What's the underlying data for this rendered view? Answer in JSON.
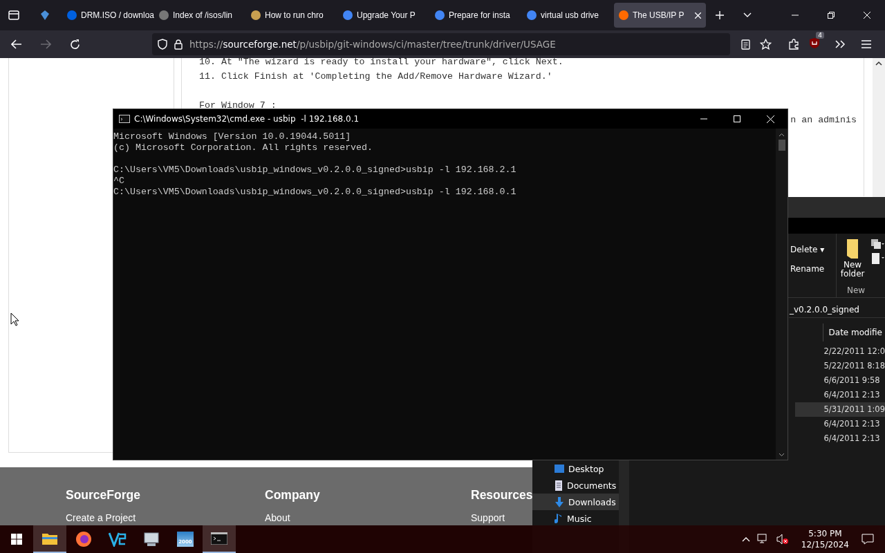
{
  "browser": {
    "tabs": [
      {
        "label": "DRM.ISO / downloa",
        "selected": false
      },
      {
        "label": "Index of /isos/lin",
        "selected": false
      },
      {
        "label": "How to run chro",
        "selected": false
      },
      {
        "label": "Upgrade Your P",
        "selected": false
      },
      {
        "label": "Prepare for insta",
        "selected": false
      },
      {
        "label": "virtual usb drive",
        "selected": false
      },
      {
        "label": "The USB/IP P",
        "selected": true
      }
    ],
    "forward_disabled": true,
    "url": {
      "scheme": "https://",
      "domain": "sourceforge.net",
      "path": "/p/usbip/git-windows/ci/master/tree/trunk/driver/USAGE"
    },
    "extension_badge": "4"
  },
  "page": {
    "lines": [
      {
        "text": "10. At \"The wizard is ready to install your hardware\", click Next.",
        "gap_before": false
      },
      {
        "text": "11. Click Finish at 'Completing the Add/Remove Hardware Wizard.'",
        "gap_before": false
      },
      {
        "text": "For Window 7 :",
        "gap_before": true
      }
    ],
    "partial_line": "n an adminis",
    "footer": [
      {
        "heading": "SourceForge",
        "link": "Create a Project"
      },
      {
        "heading": "Company",
        "link": "About"
      },
      {
        "heading": "Resources",
        "link": "Support"
      }
    ]
  },
  "explorer": {
    "delete": "Delete",
    "delete_caret": "▾",
    "rename": "Rename",
    "new_folder": "New folder",
    "group": "New",
    "address": "_v0.2.0.0_signed",
    "column": "Date modifie",
    "rows": [
      {
        "date": "2/22/2011 12:0",
        "selected": false
      },
      {
        "date": "5/22/2011 8:18",
        "selected": false
      },
      {
        "date": "6/6/2011 9:58",
        "selected": false
      },
      {
        "date": "6/4/2011 2:13",
        "selected": false
      },
      {
        "date": "5/31/2011 1:09",
        "selected": true
      },
      {
        "date": "6/4/2011 2:13",
        "selected": false
      },
      {
        "date": "6/4/2011 2:13",
        "selected": false
      }
    ],
    "nav": [
      {
        "kind": "desktop",
        "label": "Desktop",
        "selected": false
      },
      {
        "kind": "documents",
        "label": "Documents",
        "selected": false
      },
      {
        "kind": "downloads",
        "label": "Downloads",
        "selected": true
      },
      {
        "kind": "music",
        "label": "Music",
        "selected": false
      }
    ]
  },
  "cmd": {
    "title": "C:\\Windows\\System32\\cmd.exe - usbip  -l 192.168.0.1",
    "blocks": [
      [
        "Microsoft Windows [Version 10.0.19044.5011]",
        "(c) Microsoft Corporation. All rights reserved."
      ],
      [
        "C:\\Users\\VM5\\Downloads\\usbip_windows_v0.2.0.0_signed>usbip -l 192.168.2.1",
        "^C",
        "C:\\Users\\VM5\\Downloads\\usbip_windows_v0.2.0.0_signed>usbip -l 192.168.0.1"
      ]
    ]
  },
  "taskbar": {
    "apps": [
      {
        "kind": "files",
        "active": true
      },
      {
        "kind": "firefox",
        "active": false
      },
      {
        "kind": "vs",
        "active": false
      },
      {
        "kind": "monitor",
        "active": false
      },
      {
        "kind": "app2000",
        "active": false
      },
      {
        "kind": "terminal",
        "active": true
      }
    ],
    "app2000_label": "2000",
    "time": "5:30 PM",
    "date": "12/15/2024"
  }
}
